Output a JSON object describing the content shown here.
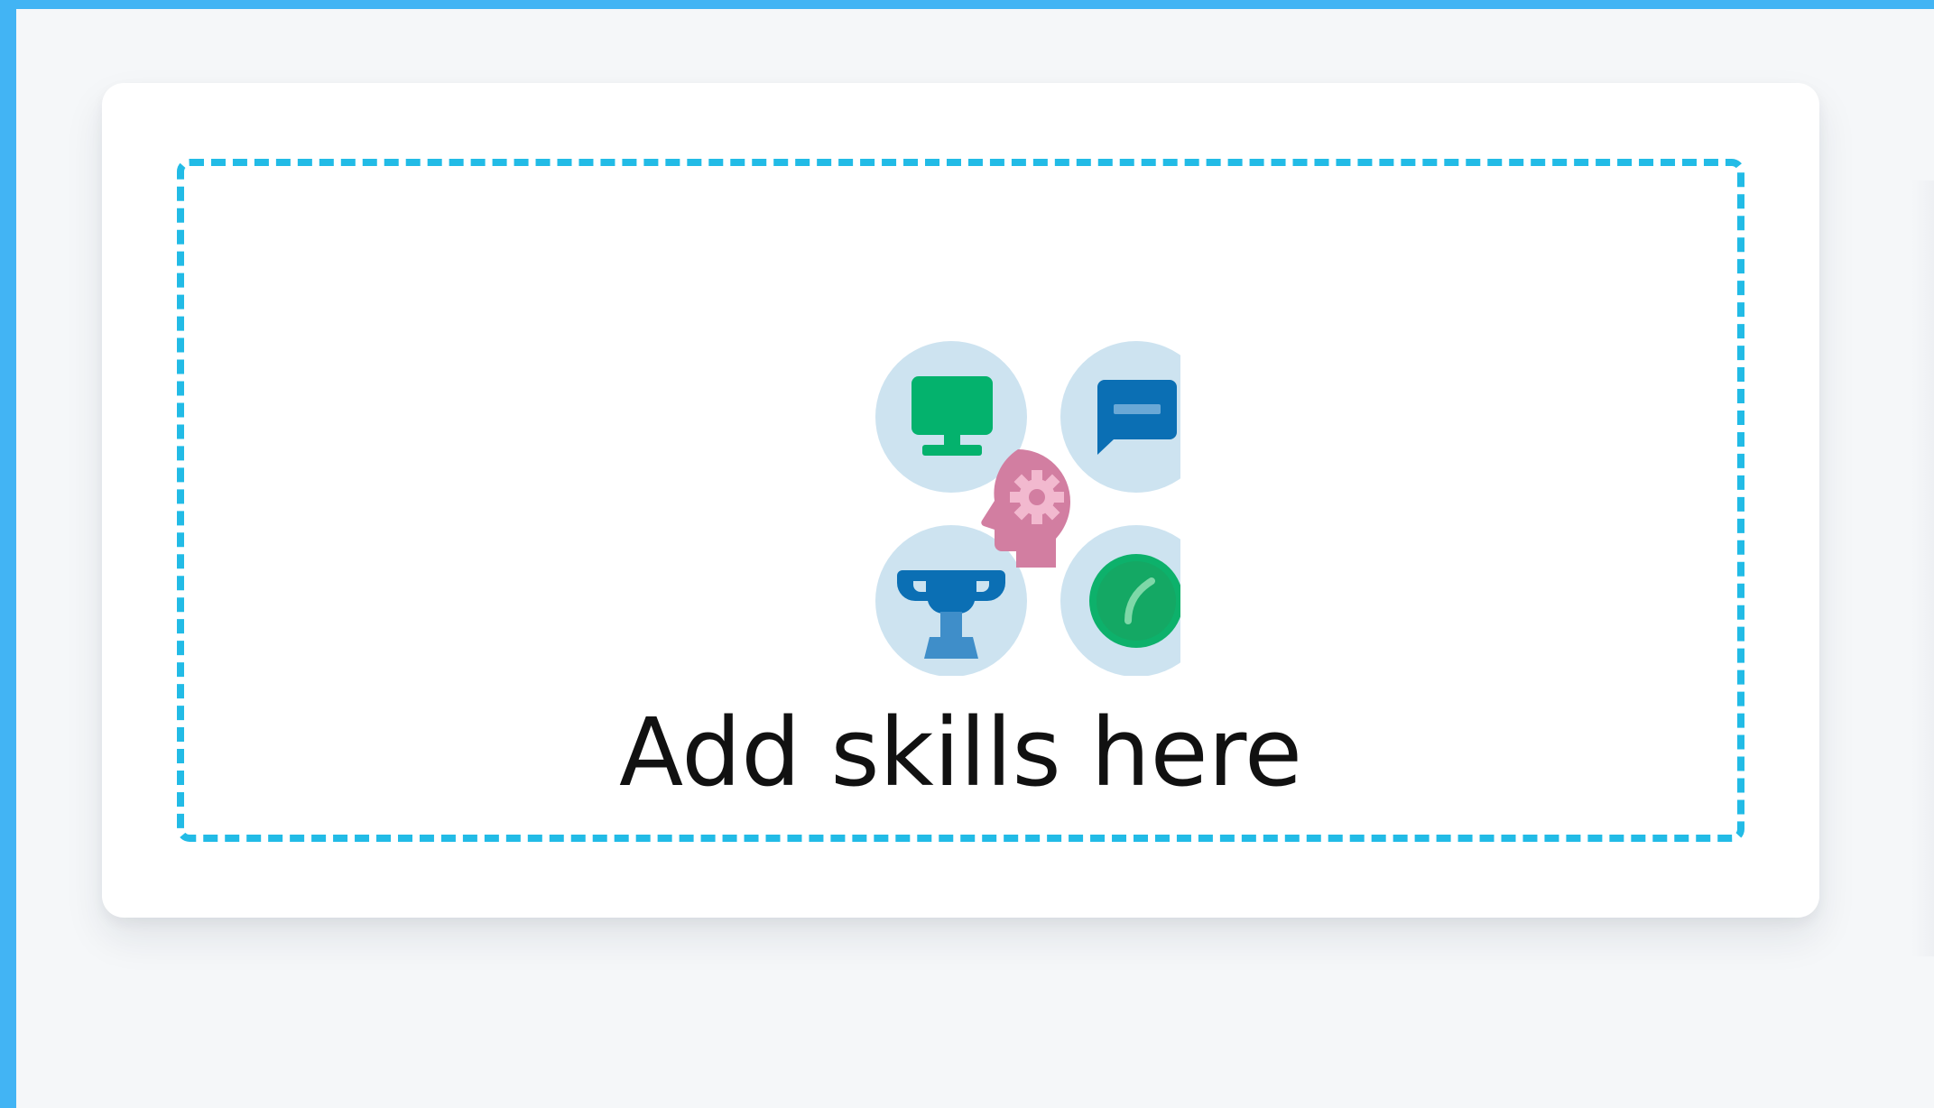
{
  "dropzone": {
    "label": "Add skills here",
    "icon": "skills-cluster-icon"
  },
  "icons": {
    "top_left": "monitor-icon",
    "top_right": "chat-bubble-icon",
    "center": "head-gear-icon",
    "bottom_left": "trophy-icon",
    "bottom_right": "speedometer-icon"
  },
  "colors": {
    "frame": "#42b4f4",
    "dashed_border": "#22bbe6",
    "circle_bg": "#cde3f0",
    "green": "#04b26d",
    "blue": "#0b6fb4",
    "pink": "#d27ea1",
    "text": "#111111"
  }
}
